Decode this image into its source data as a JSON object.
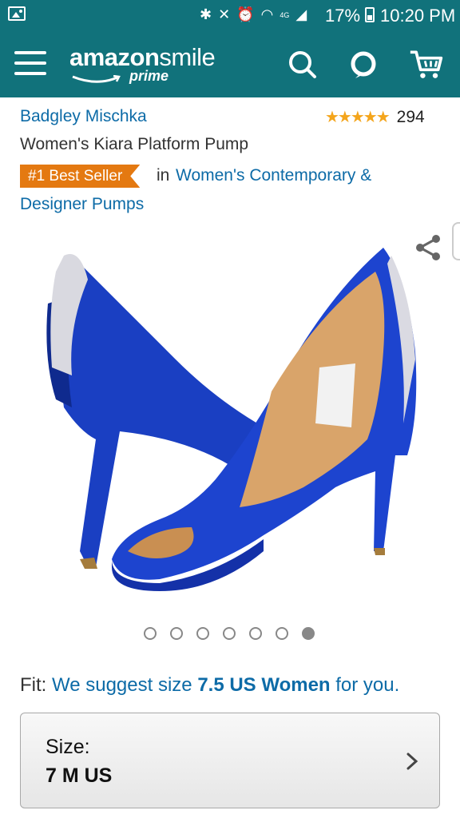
{
  "status_bar": {
    "battery": "17%",
    "time": "10:20 PM",
    "network": "4G"
  },
  "header": {
    "logo_brand": "amazon",
    "logo_smile": "smile",
    "logo_prime": "prime",
    "icons": [
      "menu-icon",
      "search-icon",
      "alexa-icon",
      "cart-icon"
    ],
    "color": "#11727b"
  },
  "product": {
    "brand": "Badgley Mischka",
    "rating_stars": 4.5,
    "rating_count": "294",
    "title": "Women's Kiara Platform Pump",
    "badge": "#1 Best Seller",
    "badge_in": "in",
    "category_line1": "Women's Contemporary &",
    "category_line2": "Designer Pumps"
  },
  "gallery": {
    "image_count": 7,
    "active_index": 6
  },
  "fit": {
    "label": "Fit:",
    "text_before": "We suggest size",
    "size": "7.5 US Women",
    "text_after": "for you."
  },
  "size_selector": {
    "label": "Size:",
    "value": "7 M US"
  },
  "colors": {
    "link": "#0d6ba7",
    "badge": "#e47911",
    "star": "#f4a51c"
  }
}
